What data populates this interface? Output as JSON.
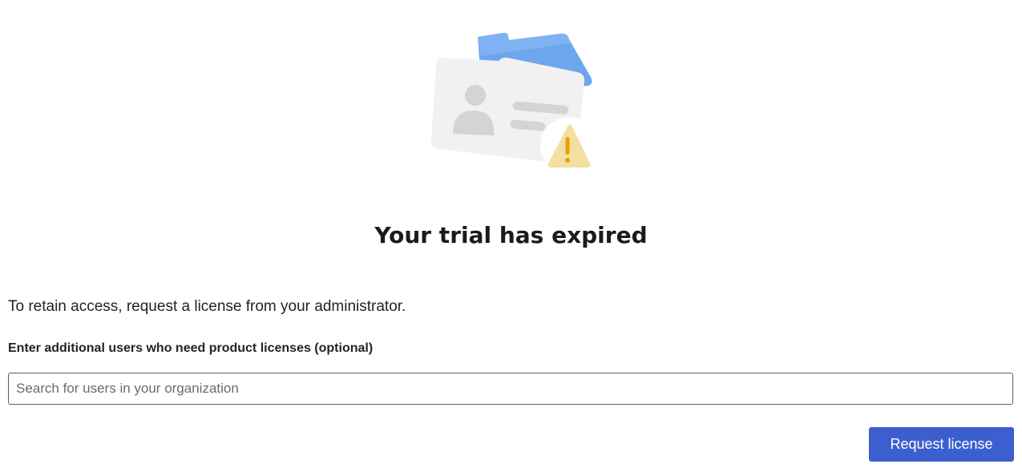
{
  "illustration": {
    "icon": "expired-license-icon",
    "colors": {
      "folder": "#6ea6ee",
      "card": "#f1f1f1",
      "card_detail": "#d4d4d4",
      "warning_fill": "#f5dfa0",
      "warning_mark": "#e6a100"
    }
  },
  "title": "Your trial has expired",
  "description": "To retain access, request a license from your administrator.",
  "users_field": {
    "label": "Enter additional users who need product licenses (optional)",
    "value": "",
    "placeholder": "Search for users in your organization"
  },
  "request_button": {
    "label": "Request license",
    "color": "#3b5fcf"
  }
}
